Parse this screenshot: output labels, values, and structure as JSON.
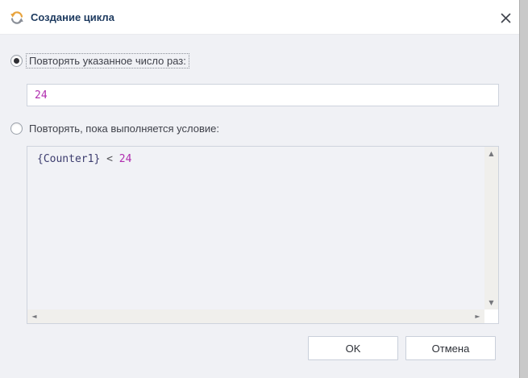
{
  "window": {
    "title": "Создание цикла"
  },
  "options": {
    "repeat_count": {
      "label": "Повторять указанное число раз:",
      "selected": true,
      "value": "24"
    },
    "repeat_while": {
      "label": "Повторять, пока выполняется условие:",
      "selected": false,
      "expression": {
        "field": "{Counter1}",
        "operator": "<",
        "value": "24"
      }
    }
  },
  "buttons": {
    "ok": "OK",
    "cancel": "Отмена"
  },
  "icons": {
    "loop": "loop-icon",
    "close": "close-icon",
    "scroll_up": "▲",
    "scroll_down": "▼",
    "scroll_left": "◄",
    "scroll_right": "►"
  },
  "colors": {
    "title_text": "#1d3a5f",
    "titlebar_bg": "#ffffff",
    "body_bg": "#f0f1f5",
    "field_border": "#ced3dd",
    "loop_icon_orange": "#e8a33d",
    "loop_icon_gray": "#8a8f98",
    "expression_field": "#3c3c6e",
    "expression_operator": "#55555a",
    "expression_number": "#b02daf",
    "input_value": "#b02daf"
  }
}
